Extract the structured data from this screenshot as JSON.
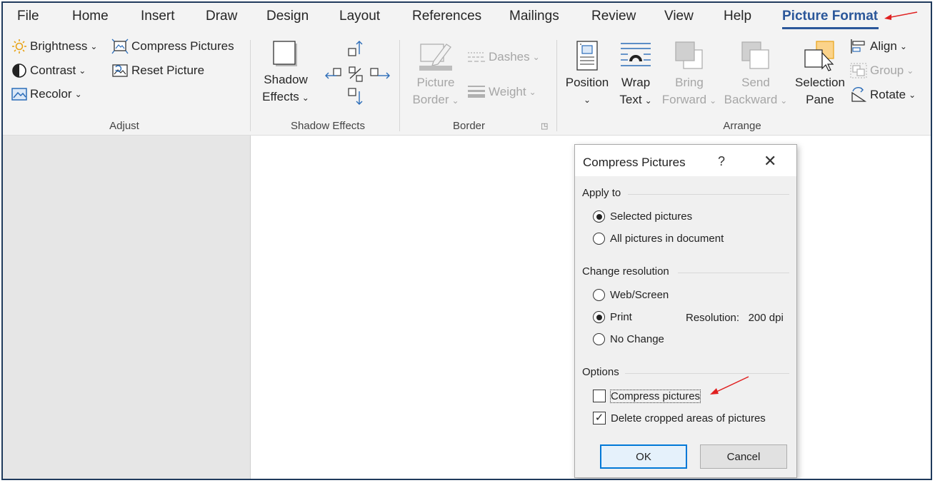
{
  "tabs": [
    "File",
    "Home",
    "Insert",
    "Draw",
    "Design",
    "Layout",
    "References",
    "Mailings",
    "Review",
    "View",
    "Help",
    "Picture Format"
  ],
  "ribbon": {
    "adjust": {
      "brightness": "Brightness",
      "contrast": "Contrast",
      "recolor": "Recolor",
      "compress": "Compress Pictures",
      "reset": "Reset Picture",
      "label": "Adjust"
    },
    "shadow": {
      "btn_line1": "Shadow",
      "btn_line2": "Effects",
      "label": "Shadow Effects"
    },
    "border": {
      "btn_line1": "Picture",
      "btn_line2": "Border",
      "dashes": "Dashes",
      "weight": "Weight",
      "label": "Border"
    },
    "arrange": {
      "position": "Position",
      "wrap_line1": "Wrap",
      "wrap_line2": "Text",
      "bring_line1": "Bring",
      "bring_line2": "Forward",
      "send_line1": "Send",
      "send_line2": "Backward",
      "sel_line1": "Selection",
      "sel_line2": "Pane",
      "align": "Align",
      "group": "Group",
      "rotate": "Rotate",
      "label": "Arrange"
    }
  },
  "dialog": {
    "title": "Compress Pictures",
    "help": "?",
    "apply_to": "Apply to",
    "selected_pictures": "Selected pictures",
    "all_pictures": "All pictures in document",
    "change_resolution": "Change resolution",
    "web_screen": "Web/Screen",
    "print": "Print",
    "no_change": "No Change",
    "resolution_label": "Resolution:",
    "resolution_value": "200 dpi",
    "options": "Options",
    "compress_pictures": "Compress pictures",
    "delete_cropped": "Delete cropped areas of pictures",
    "ok": "OK",
    "cancel": "Cancel"
  },
  "colors": {
    "accent": "#2b579a",
    "annotation_arrow": "#e02020"
  }
}
